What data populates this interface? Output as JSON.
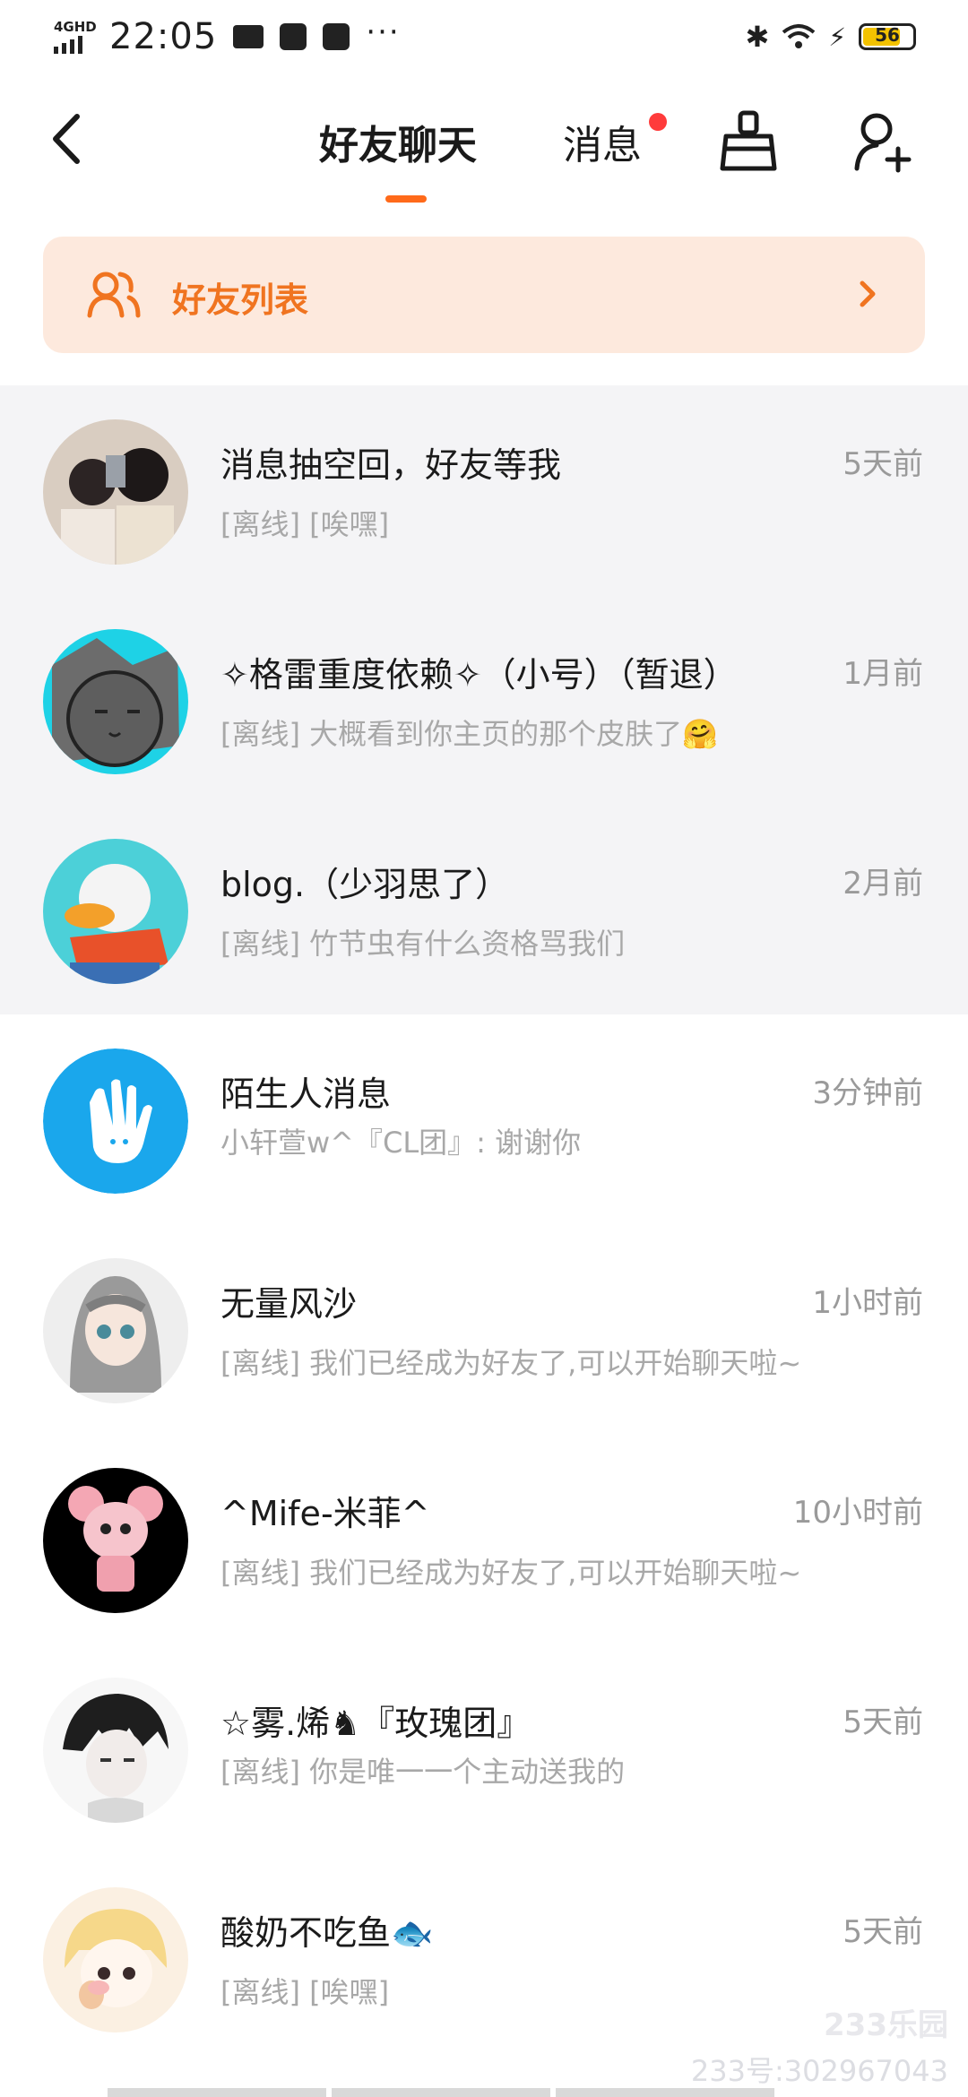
{
  "status_bar": {
    "network": "4GHD",
    "time": "22:05",
    "battery": "56",
    "more": "···"
  },
  "header": {
    "back_icon": "chevron-left-icon",
    "tab_friends": "好友聊天",
    "tab_messages": "消息",
    "unread_dot_color": "#ff3b3b",
    "accent_color": "#ff6a1a"
  },
  "banner": {
    "label": "好友列表",
    "icon": "people-icon",
    "color": "#f07420"
  },
  "chats": [
    {
      "name": "消息抽空回，好友等我",
      "time": "5天前",
      "preview": "[离线] [唉嘿]",
      "pinned": true
    },
    {
      "name": "✧格雷重度依赖✧（小号）（暂退）",
      "time": "1月前",
      "preview": "[离线] 大概看到你主页的那个皮肤了🤗",
      "pinned": true
    },
    {
      "name": "blog.（少羽思了）",
      "time": "2月前",
      "preview": "[离线] 竹节虫有什么资格骂我们",
      "pinned": true
    },
    {
      "name": "陌生人消息",
      "time": "3分钟前",
      "preview": "小轩萱w^『CL团』: 谢谢你",
      "pinned": false
    },
    {
      "name": "无量风沙",
      "time": "1小时前",
      "preview": "[离线] 我们已经成为好友了,可以开始聊天啦~",
      "pinned": false
    },
    {
      "name": "^Mife-米菲^",
      "time": "10小时前",
      "preview": "[离线] 我们已经成为好友了,可以开始聊天啦~",
      "pinned": false
    },
    {
      "name": "☆雾.烯♞『玫瑰团』",
      "time": "5天前",
      "preview": "[离线] 你是唯一一个主动送我的",
      "pinned": false
    },
    {
      "name": "酸奶不吃鱼🐟",
      "time": "5天前",
      "preview": "[离线] [唉嘿]",
      "pinned": false
    }
  ],
  "watermark": {
    "logo": "233乐园",
    "id": "233号:302967043"
  }
}
